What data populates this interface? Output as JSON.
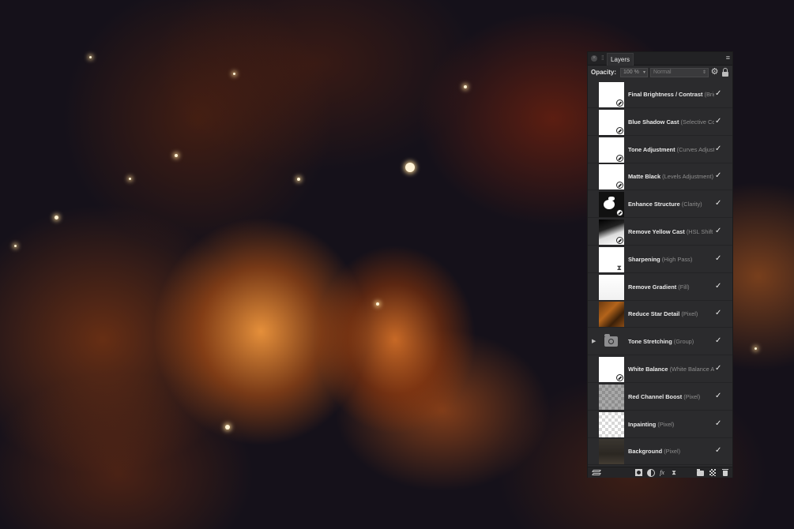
{
  "canvas": {
    "description_icon": "astrophotography-image"
  },
  "panel": {
    "tab_label": "Layers",
    "opacity_label": "Opacity:",
    "opacity_value": "100 %",
    "blend_mode": "Normal",
    "icons": {
      "close": "close-icon",
      "menu": "panel-menu-icon",
      "settings": "gear-icon",
      "lock": "lock-icon"
    }
  },
  "layers": [
    {
      "name": "Final Brightness / Contrast",
      "type": "(Brightness / Contrast Adjustment)",
      "thumb": "adjust",
      "visible": "✓"
    },
    {
      "name": "Blue Shadow Cast",
      "type": "(Selective Colour Adjustment)",
      "thumb": "adjust",
      "visible": "✓"
    },
    {
      "name": "Tone Adjustment",
      "type": "(Curves Adjustment)",
      "thumb": "adjust",
      "visible": "✓"
    },
    {
      "name": "Matte Black",
      "type": "(Levels Adjustment)",
      "thumb": "adjust",
      "visible": "✓"
    },
    {
      "name": "Enhance Structure",
      "type": "(Clarity)",
      "thumb": "mask-dark",
      "visible": "✓"
    },
    {
      "name": "Remove Yellow Cast",
      "type": "(HSL Shift Adjustment)",
      "thumb": "mask-grad",
      "visible": "✓"
    },
    {
      "name": "Sharpening",
      "type": "(High Pass)",
      "thumb": "highpass",
      "visible": "✓"
    },
    {
      "name": "Remove Gradient",
      "type": "(Fill)",
      "thumb": "fill",
      "visible": "✓"
    },
    {
      "name": "Reduce Star Detail",
      "type": "(Pixel)",
      "thumb": "star-img",
      "visible": "✓"
    },
    {
      "name": "Tone Stretching",
      "type": "(Group)",
      "thumb": "group",
      "visible": "✓",
      "expander": "▶"
    },
    {
      "name": "White Balance",
      "type": "(White Balance Adjustment)",
      "thumb": "adjust",
      "visible": "✓"
    },
    {
      "name": "Red Channel Boost",
      "type": "(Pixel)",
      "thumb": "checker-dark",
      "visible": "✓"
    },
    {
      "name": "Inpainting",
      "type": "(Pixel)",
      "thumb": "checker",
      "visible": "✓"
    },
    {
      "name": "Background",
      "type": "(Pixel)",
      "thumb": "dark-img",
      "visible": "✓"
    }
  ],
  "footer": {
    "fx_label": "fx",
    "icons": [
      "layers-icon",
      "mask-icon",
      "adjustment-icon",
      "fx-icon",
      "live-filter-icon",
      "group-icon",
      "pixel-layer-icon",
      "trash-icon"
    ]
  }
}
